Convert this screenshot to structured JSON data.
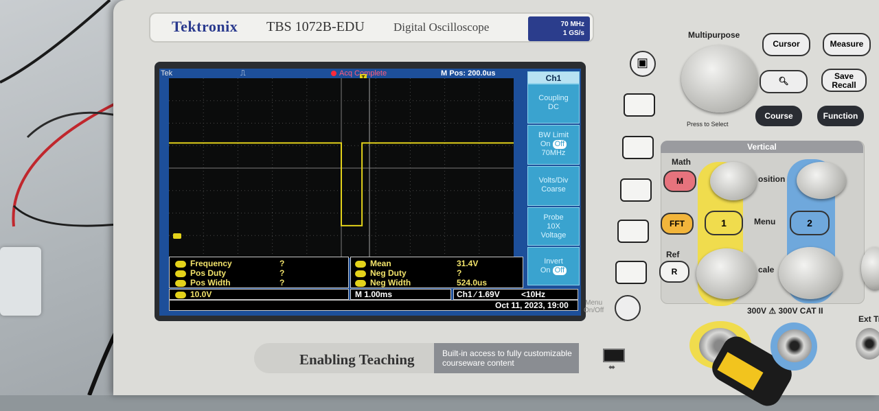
{
  "brand": {
    "name": "Tektronix",
    "model": "TBS 1072B-EDU",
    "description": "Digital Oscilloscope",
    "bandwidth": "70 MHz",
    "sample_rate": "1 GS/s"
  },
  "screen": {
    "status": {
      "brand_short": "Tek",
      "acquisition": "Acq Complete",
      "main_position": "M Pos: 200.0us"
    },
    "trigger_marker": "T",
    "channel_marker": "1",
    "waveform": {
      "color": "#e3d21a",
      "high_level_fraction": 0.36,
      "low_level_fraction": 0.82,
      "pulse_start_fraction": 0.5,
      "pulse_end_fraction": 0.56
    },
    "side_menu": {
      "title": "Ch1",
      "items": [
        {
          "line1": "Coupling",
          "line2": "DC"
        },
        {
          "line1": "BW Limit",
          "line2a": "On",
          "line2b": "Off",
          "line3": "70MHz"
        },
        {
          "line1": "Volts/Div",
          "line2": "Coarse"
        },
        {
          "line1": "Probe",
          "line2": "10X",
          "line3": "Voltage"
        },
        {
          "line1": "Invert",
          "line2a": "On",
          "line2b": "Off"
        }
      ]
    },
    "measurements_left": [
      {
        "label": "Frequency",
        "value": "?"
      },
      {
        "label": "Pos Duty",
        "value": "?"
      },
      {
        "label": "Pos Width",
        "value": "?"
      }
    ],
    "measurements_right": [
      {
        "label": "Mean",
        "value": "31.4V"
      },
      {
        "label": "Neg Duty",
        "value": "?"
      },
      {
        "label": "Neg Width",
        "value": "524.0us"
      }
    ],
    "channel_scale": "10.0V",
    "timebase": "M 1.00ms",
    "trigger_info": "Ch1 ⁄ 1.69V",
    "trigger_freq": "<10Hz",
    "datetime": "Oct 11, 2023, 19:00"
  },
  "panel": {
    "multipurpose": "Multipurpose",
    "press_to_select": "Press to Select",
    "cursor": "Cursor",
    "measure": "Measure",
    "save_recall_1": "Save",
    "save_recall_2": "Recall",
    "course": "Course",
    "function": "Function",
    "vertical": "Vertical",
    "math_label": "Math",
    "math_btn": "M",
    "fft": "FFT",
    "ref_label": "Ref",
    "ref_btn": "R",
    "ch1_btn": "1",
    "ch2_btn": "2",
    "menu": "Menu",
    "position": "osition",
    "scale": "cale",
    "menu_onoff_1": "Menu",
    "menu_onoff_2": "On/Off",
    "warning": "300V ⚠ 300V CAT II",
    "ext_trig": "Ext Tr"
  },
  "footer": {
    "tagline": "Enabling Teaching",
    "caption_1": "Built-in access to fully customizable",
    "caption_2": "courseware content"
  }
}
